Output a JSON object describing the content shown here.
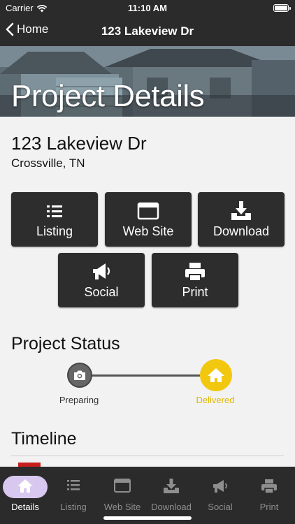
{
  "status_bar": {
    "carrier": "Carrier",
    "time": "11:10 AM"
  },
  "nav": {
    "back_label": "Home",
    "title": "123 Lakeview Dr"
  },
  "hero": {
    "title": "Project Details"
  },
  "address": {
    "street": "123 Lakeview Dr",
    "city": "Crossville, TN"
  },
  "actions": [
    {
      "label": "Listing",
      "icon": "list-icon"
    },
    {
      "label": "Web Site",
      "icon": "browser-window-icon"
    },
    {
      "label": "Download",
      "icon": "download-tray-icon"
    },
    {
      "label": "Social",
      "icon": "megaphone-icon"
    },
    {
      "label": "Print",
      "icon": "printer-icon"
    }
  ],
  "project_status": {
    "heading": "Project Status",
    "steps": [
      {
        "label": "Preparing",
        "icon": "camera-icon",
        "state": "done",
        "color": "#666666"
      },
      {
        "label": "Delivered",
        "icon": "house-icon",
        "state": "current",
        "color": "#f2c80f"
      }
    ]
  },
  "timeline": {
    "heading": "Timeline"
  },
  "tabs": [
    {
      "label": "Details",
      "icon": "house-icon",
      "active": true
    },
    {
      "label": "Listing",
      "icon": "list-icon",
      "active": false
    },
    {
      "label": "Web Site",
      "icon": "browser-window-icon",
      "active": false
    },
    {
      "label": "Download",
      "icon": "download-tray-icon",
      "active": false
    },
    {
      "label": "Social",
      "icon": "megaphone-icon",
      "active": false
    },
    {
      "label": "Print",
      "icon": "printer-icon",
      "active": false
    }
  ],
  "colors": {
    "bar": "#2b2b2b",
    "accent": "#f2c80f",
    "active_tab_pill": "#d8c8ef",
    "timeline_marker": "#c81e1e"
  }
}
